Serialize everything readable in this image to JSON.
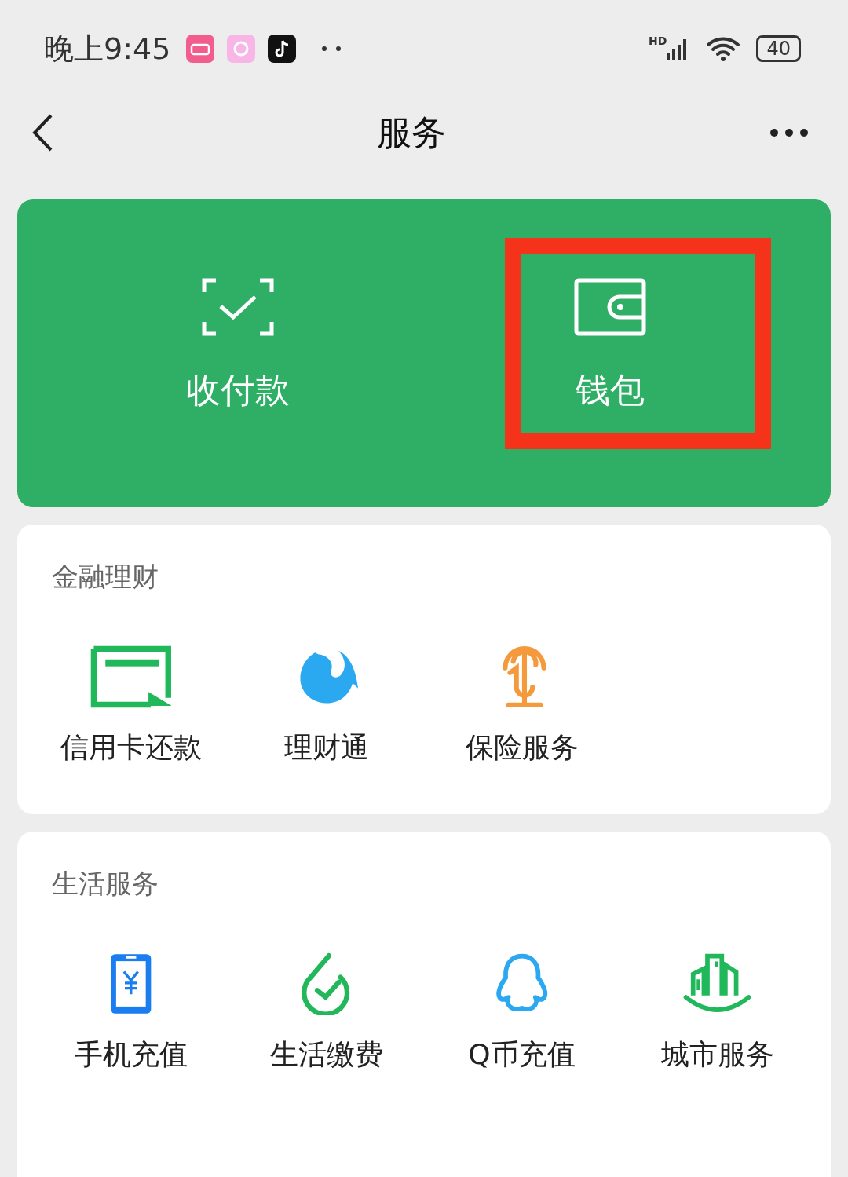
{
  "status_bar": {
    "time": "晚上9:45",
    "signal_label": "HD",
    "battery": "40"
  },
  "header": {
    "title": "服务"
  },
  "top_card": {
    "items": [
      {
        "kind": "scan",
        "label": "收付款",
        "highlighted": false
      },
      {
        "kind": "wallet",
        "label": "钱包",
        "highlighted": true
      }
    ]
  },
  "sections": [
    {
      "title": "金融理财",
      "items": [
        {
          "kind": "card",
          "label": "信用卡还款"
        },
        {
          "kind": "fish",
          "label": "理财通"
        },
        {
          "kind": "umbrella",
          "label": "保险服务"
        }
      ]
    },
    {
      "title": "生活服务",
      "items": [
        {
          "kind": "phone",
          "label": "手机充值"
        },
        {
          "kind": "check",
          "label": "生活缴费"
        },
        {
          "kind": "penguin",
          "label": "Q币充值"
        },
        {
          "kind": "city",
          "label": "城市服务"
        }
      ]
    }
  ]
}
